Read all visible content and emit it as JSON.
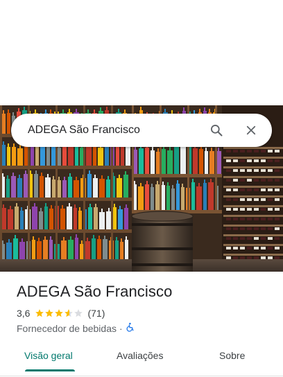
{
  "search": {
    "query": "ADEGA São Francisco"
  },
  "place": {
    "name": "ADEGA São Francisco",
    "rating": "3,6",
    "rating_value": 3.6,
    "rating_max": 5,
    "review_count": "(71)",
    "category": "Fornecedor de bebidas",
    "separator": "·"
  },
  "tabs": [
    {
      "label": "Visão geral",
      "active": true
    },
    {
      "label": "Avaliações",
      "active": false
    },
    {
      "label": "Sobre",
      "active": false
    }
  ],
  "colors": {
    "accent": "#00786c",
    "star": "#fbbc04",
    "star_empty": "#dadce0",
    "accessibility": "#1a73e8"
  },
  "icons": {
    "search": "search-icon",
    "close": "close-icon",
    "accessibility": "wheelchair-accessible-icon",
    "star": "star-icon"
  }
}
